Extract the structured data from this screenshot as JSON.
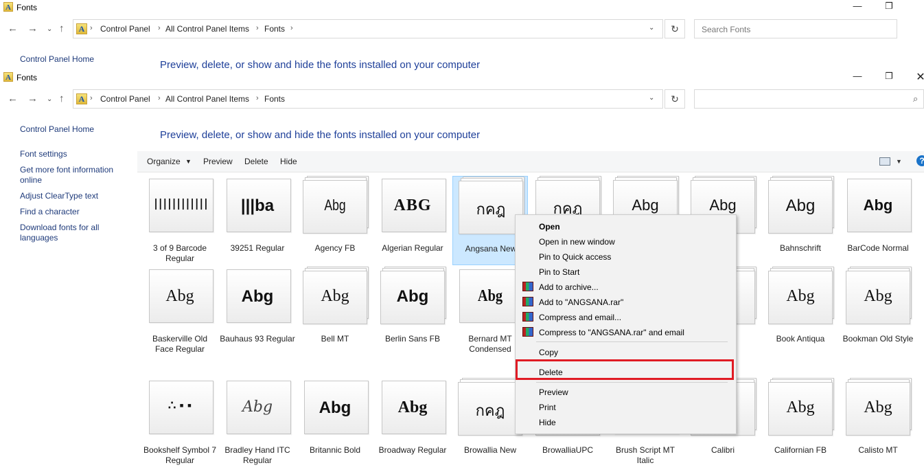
{
  "back_window": {
    "title": "Fonts",
    "breadcrumbs": [
      "Control Panel",
      "All Control Panel Items",
      "Fonts"
    ],
    "search_placeholder": "Search Fonts",
    "sidebar_home": "Control Panel Home",
    "heading": "Preview, delete, or show and hide the fonts installed on your computer"
  },
  "front_window": {
    "title": "Fonts",
    "breadcrumbs": [
      "Control Panel",
      "All Control Panel Items",
      "Fonts"
    ],
    "search_placeholder": "",
    "heading": "Preview, delete, or show and hide the fonts installed on your computer"
  },
  "sidebar": {
    "items": [
      {
        "label": "Control Panel Home"
      },
      {
        "label": "Font settings"
      },
      {
        "label": "Get more font information online"
      },
      {
        "label": "Adjust ClearType text"
      },
      {
        "label": "Find a character"
      },
      {
        "label": "Download fonts for all languages"
      }
    ]
  },
  "toolbar": {
    "organize": "Organize",
    "preview": "Preview",
    "delete": "Delete",
    "hide": "Hide",
    "help": "?"
  },
  "fonts": [
    {
      "name": "3 of 9 Barcode Regular",
      "glyph": "||||||||||||",
      "stacked": false
    },
    {
      "name": "39251 Regular",
      "glyph": "|||ba",
      "stacked": false
    },
    {
      "name": "Agency FB",
      "glyph": "Abg",
      "stacked": true
    },
    {
      "name": "Algerian Regular",
      "glyph": "ABG",
      "stacked": false
    },
    {
      "name": "Angsana New",
      "glyph": "กคฎ",
      "stacked": true,
      "selected": true
    },
    {
      "name": "",
      "glyph": "กคฎ",
      "stacked": true
    },
    {
      "name": "",
      "glyph": "Abg",
      "stacked": true
    },
    {
      "name": "nded\nld",
      "glyph": "Abg",
      "stacked": true
    },
    {
      "name": "Bahnschrift",
      "glyph": "Abg",
      "stacked": true
    },
    {
      "name": "BarCode Normal",
      "glyph": "Abg",
      "stacked": false
    },
    {
      "name": "Baskerville Old Face Regular",
      "glyph": "Abg",
      "stacked": false
    },
    {
      "name": "Bauhaus 93 Regular",
      "glyph": "Abg",
      "stacked": false
    },
    {
      "name": "Bell MT",
      "glyph": "Abg",
      "stacked": true
    },
    {
      "name": "Berlin Sans FB",
      "glyph": "Abg",
      "stacked": true
    },
    {
      "name": "Bernard MT Condensed",
      "glyph": "Abg",
      "stacked": false
    },
    {
      "name": "",
      "glyph": "",
      "stacked": true
    },
    {
      "name": "",
      "glyph": "",
      "stacked": true
    },
    {
      "name": "MT\nr\nsed",
      "glyph": "",
      "stacked": true
    },
    {
      "name": "Book Antiqua",
      "glyph": "Abg",
      "stacked": true
    },
    {
      "name": "Bookman Old Style",
      "glyph": "Abg",
      "stacked": true
    },
    {
      "name": "Bookshelf Symbol 7 Regular",
      "glyph": "∴ ▪ ▪",
      "stacked": false
    },
    {
      "name": "Bradley Hand ITC Regular",
      "glyph": "Abg",
      "stacked": false
    },
    {
      "name": "Britannic Bold",
      "glyph": "Abg",
      "stacked": false
    },
    {
      "name": "Broadway Regular",
      "glyph": "Abg",
      "stacked": false
    },
    {
      "name": "Browallia New",
      "glyph": "กคฎ",
      "stacked": true
    },
    {
      "name": "BrowalliaUPC",
      "glyph": "",
      "stacked": true
    },
    {
      "name": "Brush Script MT Italic",
      "glyph": "",
      "stacked": false
    },
    {
      "name": "Calibri",
      "glyph": "g",
      "stacked": true
    },
    {
      "name": "Californian FB",
      "glyph": "Abg",
      "stacked": true
    },
    {
      "name": "Calisto MT",
      "glyph": "Abg",
      "stacked": true
    }
  ],
  "context_menu": {
    "items": [
      {
        "label": "Open",
        "bold": true
      },
      {
        "label": "Open in new window"
      },
      {
        "label": "Pin to Quick access"
      },
      {
        "label": "Pin to Start"
      },
      {
        "label": "Add to archive...",
        "icon": "winrar-icon"
      },
      {
        "label": "Add to \"ANGSANA.rar\"",
        "icon": "winrar-icon"
      },
      {
        "label": "Compress and email...",
        "icon": "winrar-icon"
      },
      {
        "label": "Compress to \"ANGSANA.rar\" and email",
        "icon": "winrar-icon"
      },
      {
        "label": "Copy"
      },
      {
        "label": "Delete",
        "highlighted": true
      },
      {
        "label": "Preview"
      },
      {
        "label": "Print"
      },
      {
        "label": "Hide"
      }
    ],
    "highlight_color": "#e01b24"
  }
}
